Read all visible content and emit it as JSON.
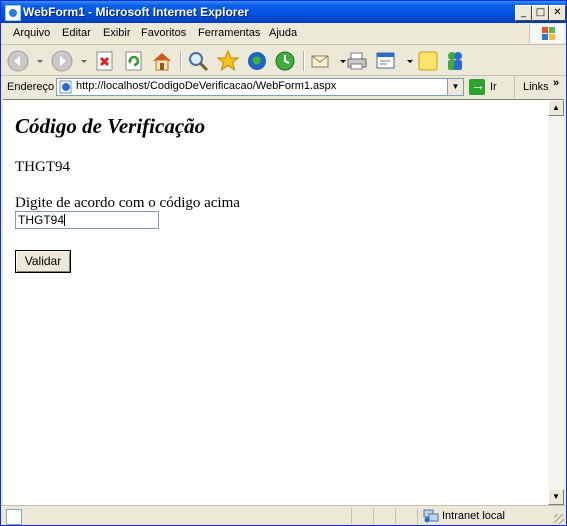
{
  "window": {
    "title": "WebForm1 - Microsoft Internet Explorer",
    "min": "_",
    "max": "□",
    "close": "✕"
  },
  "menu": [
    {
      "label": "Arquivo"
    },
    {
      "label": "Editar"
    },
    {
      "label": "Exibir"
    },
    {
      "label": "Favoritos"
    },
    {
      "label": "Ferramentas"
    },
    {
      "label": "Ajuda"
    }
  ],
  "address": {
    "label": "Endereço",
    "url": "http://localhost/CodigoDeVerificacao/WebForm1.aspx",
    "go_label": "Ir",
    "links_label": "Links",
    "links_chevron": "»"
  },
  "page": {
    "title": "Código de Verificação",
    "code": "THGT94",
    "instruction": "Digite de acordo com o código acima",
    "input_value": "THGT94",
    "button_label": "Validar"
  },
  "status": {
    "zone": "Intranet local"
  },
  "colors": {
    "titlebar": "#0054e3",
    "chrome": "#ece9d8",
    "content_bg": "#ffffff"
  }
}
